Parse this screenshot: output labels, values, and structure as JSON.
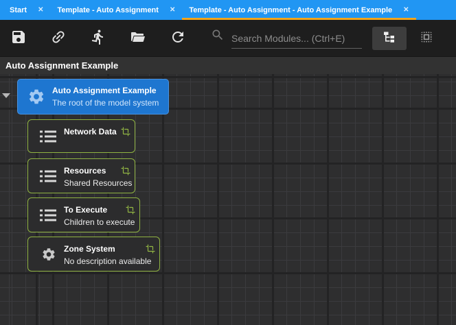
{
  "tab_bar": {
    "close_glyph": "✕",
    "tabs": [
      {
        "label": "Start",
        "active": false
      },
      {
        "label": "Template - Auto Assignment",
        "active": false
      },
      {
        "label": "Template - Auto Assignment - Auto Assignment Example",
        "active": true
      }
    ]
  },
  "toolbar": {
    "buttons": [
      {
        "name": "save"
      },
      {
        "name": "link"
      },
      {
        "name": "run"
      },
      {
        "name": "open-folder"
      },
      {
        "name": "refresh"
      }
    ],
    "search": {
      "placeholder": "Search Modules... (Ctrl+E)",
      "value": ""
    },
    "view_toggles": [
      {
        "name": "tree-view",
        "active": true
      },
      {
        "name": "select-region-view",
        "active": false
      }
    ]
  },
  "breadcrumb": {
    "title": "Auto Assignment Example"
  },
  "canvas": {
    "nodes": [
      {
        "title": "Auto Assignment Example",
        "subtitle": "The root of the model system",
        "icon": "gear",
        "selected": true
      },
      {
        "title": "Network Data",
        "subtitle": "",
        "icon": "list",
        "selected": false
      },
      {
        "title": "Resources",
        "subtitle": "Shared Resources",
        "icon": "list",
        "selected": false
      },
      {
        "title": "To Execute",
        "subtitle": "Children to execute",
        "icon": "list",
        "selected": false
      },
      {
        "title": "Zone System",
        "subtitle": "No description available",
        "icon": "gear",
        "selected": false
      }
    ]
  },
  "colors": {
    "tab_bar": "#2196f3",
    "active_tab_underline": "#f2a51c",
    "selected_node_blue": "#1e76d0",
    "node_outline_green": "#90b442",
    "canvas_background": "#2e2e2f"
  }
}
